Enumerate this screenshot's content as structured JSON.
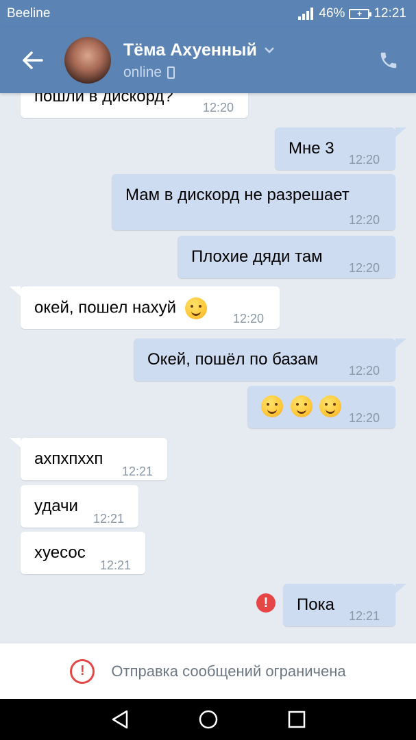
{
  "status_bar": {
    "carrier": "Beeline",
    "battery": "46%",
    "time": "12:21"
  },
  "header": {
    "name": "Тёма Ахуенный",
    "status": "online"
  },
  "messages": [
    {
      "dir": "in",
      "text": "пошли в дискорд?",
      "time": "12:20"
    },
    {
      "dir": "out",
      "text": "Мне 3",
      "time": "12:20"
    },
    {
      "dir": "out",
      "text": "Мам в дискорд не разрешает",
      "time": "12:20"
    },
    {
      "dir": "out",
      "text": "Плохие дяди там",
      "time": "12:20"
    },
    {
      "dir": "in",
      "text": "окей, пошел нахуй",
      "time": "12:20",
      "emoji": "hugging-face"
    },
    {
      "dir": "out",
      "text": "Окей, пошёл по базам",
      "time": "12:20"
    },
    {
      "dir": "out",
      "text": "",
      "time": "12:20",
      "emoji": "hugging-face x3"
    },
    {
      "dir": "in",
      "text": "ахпхпххп",
      "time": "12:21"
    },
    {
      "dir": "in",
      "text": "удачи",
      "time": "12:21"
    },
    {
      "dir": "in",
      "text": "хуесос",
      "time": "12:21"
    },
    {
      "dir": "out",
      "text": "Пока",
      "time": "12:21",
      "error": true
    }
  ],
  "notice": {
    "text": "Отправка сообщений ограничена"
  },
  "colors": {
    "header": "#5b84b5",
    "outgoing": "#cddcf0",
    "incoming": "#ffffff",
    "background": "#e6ebf2",
    "error": "#e64646"
  }
}
